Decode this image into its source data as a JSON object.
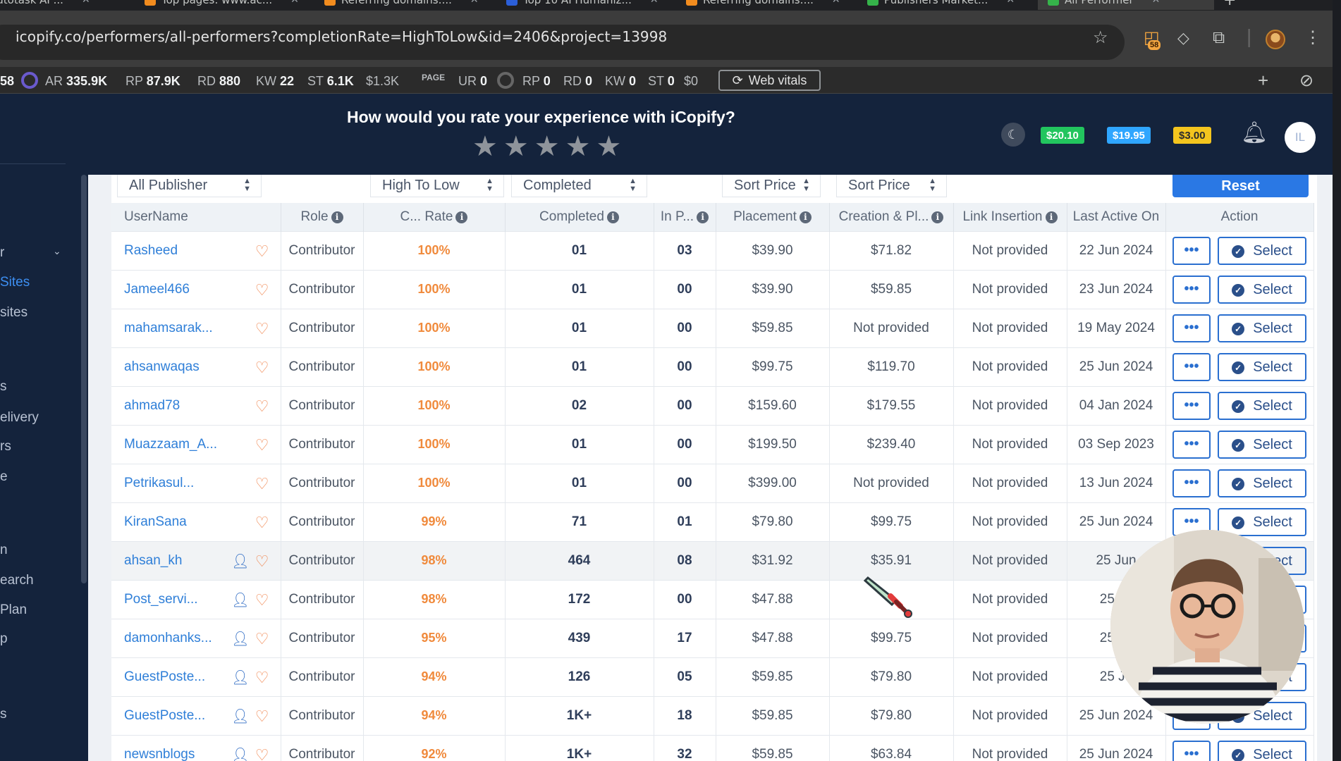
{
  "browser": {
    "tabs": [
      {
        "label": "Autotask AI ...",
        "favicon_color": "#8a8a8a"
      },
      {
        "label": "Top pages: www.ac...",
        "favicon_color": "#f28c1e"
      },
      {
        "label": "Referring domains:...",
        "favicon_color": "#f28c1e"
      },
      {
        "label": "Top 10 AI Humaniz...",
        "favicon_color": "#2b5fd9"
      },
      {
        "label": "Referring domains:...",
        "favicon_color": "#f28c1e"
      },
      {
        "label": "Publishers Market...",
        "favicon_color": "#35b34a"
      },
      {
        "label": "All Performer",
        "favicon_color": "#35b34a"
      }
    ],
    "url": "icopify.co/performers/all-performers?completionRate=HighToLow&id=2406&project=13998",
    "extension_badge": "58"
  },
  "seo_bar": {
    "prefix": "58",
    "domain_metrics": [
      {
        "label": "AR",
        "value": "335.9K"
      },
      {
        "label": "RP",
        "value": "87.9K"
      },
      {
        "label": "RD",
        "value": "880"
      },
      {
        "label": "KW",
        "value": "22"
      },
      {
        "label": "ST",
        "value": "6.1K"
      }
    ],
    "domain_traffic_cost": "$1.3K",
    "page_label": "PAGE",
    "page_metrics": [
      {
        "label": "UR",
        "value": "0"
      },
      {
        "label": "RP",
        "value": "0"
      },
      {
        "label": "RD",
        "value": "0"
      },
      {
        "label": "KW",
        "value": "0"
      },
      {
        "label": "ST",
        "value": "0"
      }
    ],
    "page_traffic_cost": "$0",
    "web_vitals_label": "Web vitals"
  },
  "header": {
    "rating_question": "How would you rate your experience with iCopify?",
    "stars": 5,
    "wallets": [
      {
        "value": "$20.10",
        "bg": "#22c55e",
        "fg": "#ffffff"
      },
      {
        "value": "$19.95",
        "bg": "#2fa6ff",
        "fg": "#ffffff"
      },
      {
        "value": "$3.00",
        "bg": "#f4c51e",
        "fg": "#2d2d2d"
      }
    ],
    "avatar_initials": "IL"
  },
  "sidebar": {
    "items": [
      {
        "label": "r",
        "active": false
      },
      {
        "label": "Sites",
        "active": true
      },
      {
        "label": "sites",
        "active": false
      },
      {
        "label": "s",
        "active": false
      },
      {
        "label": "elivery",
        "active": false
      },
      {
        "label": "rs",
        "active": false
      },
      {
        "label": "e",
        "active": false
      },
      {
        "label": "n",
        "active": false
      },
      {
        "label": "earch",
        "active": false
      },
      {
        "label": "Plan",
        "active": false
      },
      {
        "label": "p",
        "active": false
      },
      {
        "label": "s",
        "active": false
      }
    ]
  },
  "filters": {
    "publisher": "All Publisher",
    "completion_rate": "High To Low",
    "completed": "Completed",
    "sort_price_1": "Sort Price",
    "sort_price_2": "Sort Price",
    "reset_label": "Reset"
  },
  "table": {
    "columns": [
      "UserName",
      "Role",
      "C... Rate",
      "Completed",
      "In P...",
      "Placement",
      "Creation & Pl...",
      "Link Insertion",
      "Last Active On",
      "Action"
    ],
    "more_label": "•••",
    "select_label": "Select",
    "rows": [
      {
        "username": "Rasheed",
        "verified": false,
        "role": "Contributor",
        "rate": "100%",
        "completed": "01",
        "in_progress": "03",
        "placement": "$39.90",
        "creation": "$71.82",
        "link_insertion": "Not provided",
        "last_active": "22 Jun 2024"
      },
      {
        "username": "Jameel466",
        "verified": false,
        "role": "Contributor",
        "rate": "100%",
        "completed": "01",
        "in_progress": "00",
        "placement": "$39.90",
        "creation": "$59.85",
        "link_insertion": "Not provided",
        "last_active": "23 Jun 2024"
      },
      {
        "username": "mahamsarak...",
        "verified": false,
        "role": "Contributor",
        "rate": "100%",
        "completed": "01",
        "in_progress": "00",
        "placement": "$59.85",
        "creation": "Not provided",
        "link_insertion": "Not provided",
        "last_active": "19 May 2024"
      },
      {
        "username": "ahsanwaqas",
        "verified": false,
        "role": "Contributor",
        "rate": "100%",
        "completed": "01",
        "in_progress": "00",
        "placement": "$99.75",
        "creation": "$119.70",
        "link_insertion": "Not provided",
        "last_active": "25 Jun 2024"
      },
      {
        "username": "ahmad78",
        "verified": false,
        "role": "Contributor",
        "rate": "100%",
        "completed": "02",
        "in_progress": "00",
        "placement": "$159.60",
        "creation": "$179.55",
        "link_insertion": "Not provided",
        "last_active": "04 Jan 2024"
      },
      {
        "username": "Muazzaam_A...",
        "verified": false,
        "role": "Contributor",
        "rate": "100%",
        "completed": "01",
        "in_progress": "00",
        "placement": "$199.50",
        "creation": "$239.40",
        "link_insertion": "Not provided",
        "last_active": "03 Sep 2023"
      },
      {
        "username": "Petrikasul...",
        "verified": false,
        "role": "Contributor",
        "rate": "100%",
        "completed": "01",
        "in_progress": "00",
        "placement": "$399.00",
        "creation": "Not provided",
        "link_insertion": "Not provided",
        "last_active": "13 Jun 2024"
      },
      {
        "username": "KiranSana",
        "verified": false,
        "role": "Contributor",
        "rate": "99%",
        "completed": "71",
        "in_progress": "01",
        "placement": "$79.80",
        "creation": "$99.75",
        "link_insertion": "Not provided",
        "last_active": "25 Jun 2024"
      },
      {
        "username": "ahsan_kh",
        "verified": true,
        "role": "Contributor",
        "rate": "98%",
        "completed": "464",
        "in_progress": "08",
        "placement": "$31.92",
        "creation": "$35.91",
        "link_insertion": "Not provided",
        "last_active": "25 Jun",
        "highlight": true
      },
      {
        "username": "Post_servi...",
        "verified": true,
        "role": "Contributor",
        "rate": "98%",
        "completed": "172",
        "in_progress": "00",
        "placement": "$47.88",
        "creation": "",
        "link_insertion": "Not provided",
        "last_active": "25 Ju"
      },
      {
        "username": "damonhanks...",
        "verified": true,
        "role": "Contributor",
        "rate": "95%",
        "completed": "439",
        "in_progress": "17",
        "placement": "$47.88",
        "creation": "$99.75",
        "link_insertion": "Not provided",
        "last_active": "25 Ju"
      },
      {
        "username": "GuestPoste...",
        "verified": true,
        "role": "Contributor",
        "rate": "94%",
        "completed": "126",
        "in_progress": "05",
        "placement": "$59.85",
        "creation": "$79.80",
        "link_insertion": "Not provided",
        "last_active": "25 Ju"
      },
      {
        "username": "GuestPoste...",
        "verified": true,
        "role": "Contributor",
        "rate": "94%",
        "completed": "1K+",
        "in_progress": "18",
        "placement": "$59.85",
        "creation": "$79.80",
        "link_insertion": "Not provided",
        "last_active": "25 Jun 2024"
      },
      {
        "username": "newsnblogs",
        "verified": true,
        "role": "Contributor",
        "rate": "92%",
        "completed": "1K+",
        "in_progress": "32",
        "placement": "$59.85",
        "creation": "$63.84",
        "link_insertion": "Not provided",
        "last_active": "25 Jun 2024"
      }
    ]
  }
}
